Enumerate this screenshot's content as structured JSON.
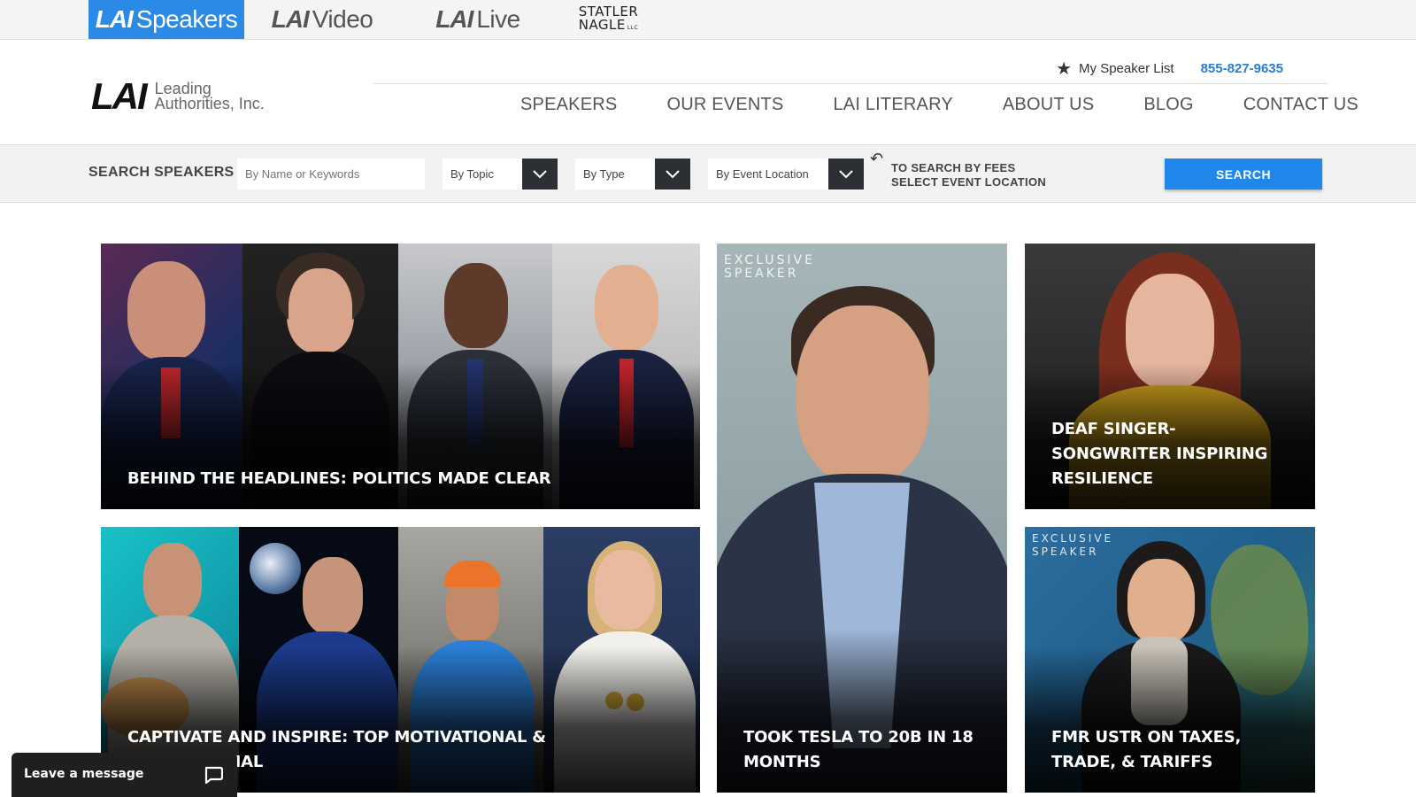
{
  "brands": [
    {
      "prefix": "LAI",
      "name": "Speakers",
      "active": true
    },
    {
      "prefix": "LAI",
      "name": "Video",
      "active": false
    },
    {
      "prefix": "LAI",
      "name": "Live",
      "active": false
    },
    {
      "line1": "STATLER",
      "line2": "NAGLE",
      "suffix": "LLC"
    }
  ],
  "logo": {
    "mark": "LAI",
    "line1": "Leading",
    "line2": "Authorities, Inc."
  },
  "utility": {
    "list_label": "My Speaker List",
    "phone": "855-827-9635"
  },
  "nav": [
    "SPEAKERS",
    "OUR EVENTS",
    "LAI LITERARY",
    "ABOUT US",
    "BLOG",
    "CONTACT US"
  ],
  "search": {
    "title": "SEARCH SPEAKERS",
    "keyword_placeholder": "By Name or Keywords",
    "topic": "By Topic",
    "type": "By Type",
    "location": "By Event Location",
    "fees_line1": "TO SEARCH BY FEES",
    "fees_line2": "SELECT EVENT LOCATION",
    "button": "SEARCH"
  },
  "tiles": [
    {
      "caption": "BEHIND THE HEADLINES: POLITICS MADE CLEAR"
    },
    {
      "caption": "TOOK TESLA TO 20B IN 18 MONTHS",
      "badge_line1": "EXCLUSIVE",
      "badge_line2": "SPEAKER"
    },
    {
      "caption": "DEAF SINGER-SONGWRITER INSPIRING RESILIENCE"
    },
    {
      "caption": "CAPTIVATE AND INSPIRE: TOP MOTIVATIONAL & INSPIRATIONAL"
    },
    {
      "caption": "FMR USTR ON TAXES, TRADE, & TARIFFS",
      "badge_line1": "EXCLUSIVE",
      "badge_line2": "SPEAKER"
    }
  ],
  "chat": {
    "label": "Leave a message"
  },
  "colors": {
    "accent": "#1f88ea",
    "brand_active": "#2a8ae6",
    "phone": "#2a7ccc",
    "dropdown": "#2c2f33"
  }
}
